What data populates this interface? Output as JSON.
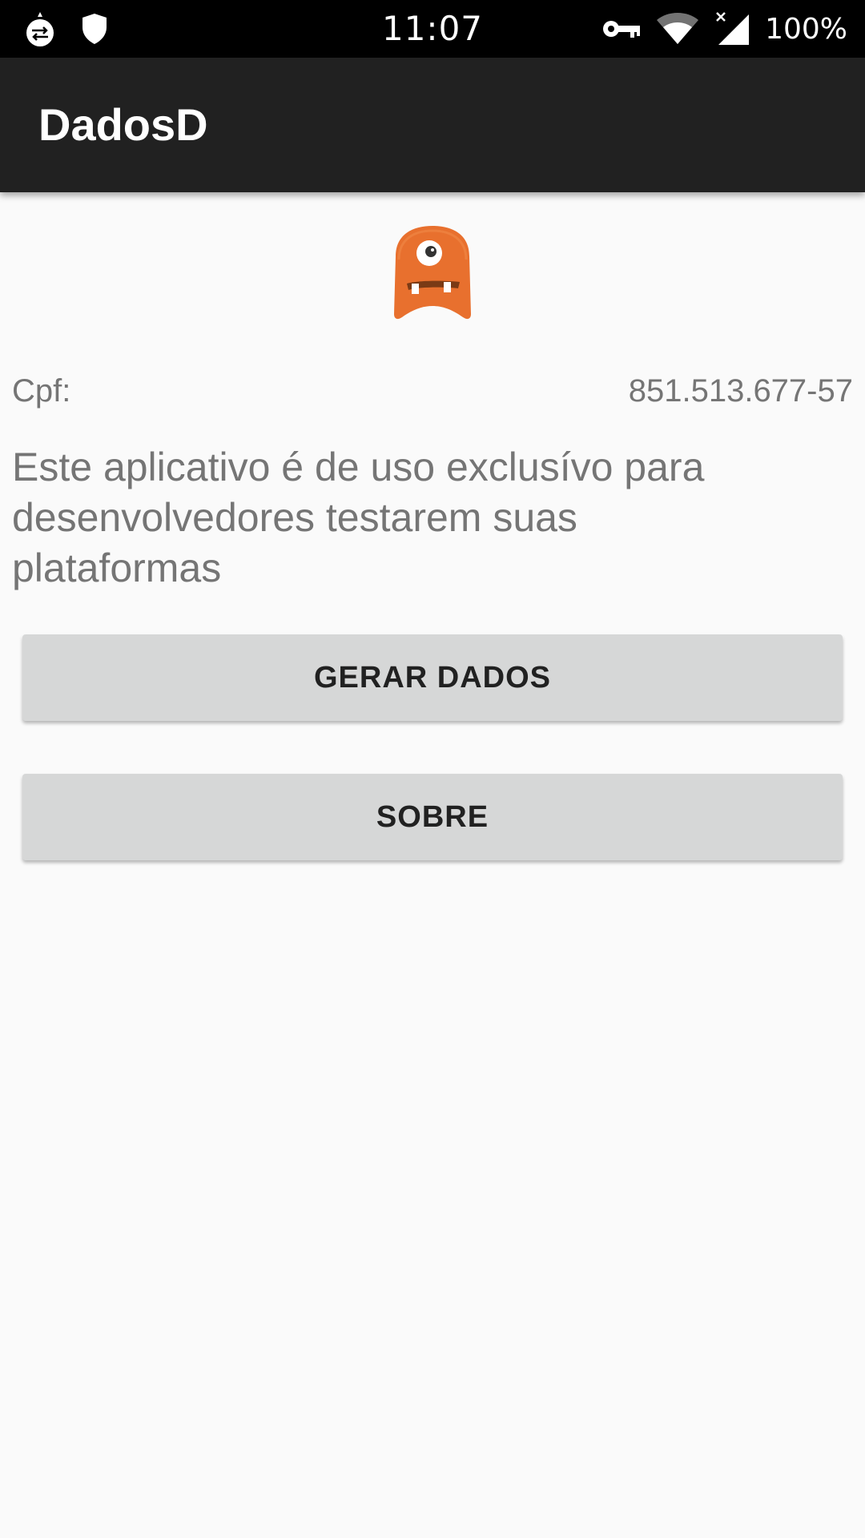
{
  "status_bar": {
    "time": "11:07",
    "battery": "100%",
    "left_icons": [
      "sync-app-icon",
      "shield-icon"
    ],
    "right_icons": [
      "vpn-key-icon",
      "wifi-icon",
      "signal-icon",
      "battery-icon"
    ]
  },
  "app_bar": {
    "title": "DadosD"
  },
  "main": {
    "cpf_label": "Cpf:",
    "cpf_value": "851.513.677-57",
    "description": "Este aplicativo é de uso exclusívo para desenvolvedores testarem suas plataformas",
    "generate_button_label": "GERAR DADOS",
    "about_button_label": "SOBRE"
  },
  "colors": {
    "status_bar": "#000000",
    "app_bar": "#212121",
    "background": "#fafafa",
    "button": "#d6d7d7",
    "text_secondary": "#757575",
    "mascot": "#e8702e"
  }
}
